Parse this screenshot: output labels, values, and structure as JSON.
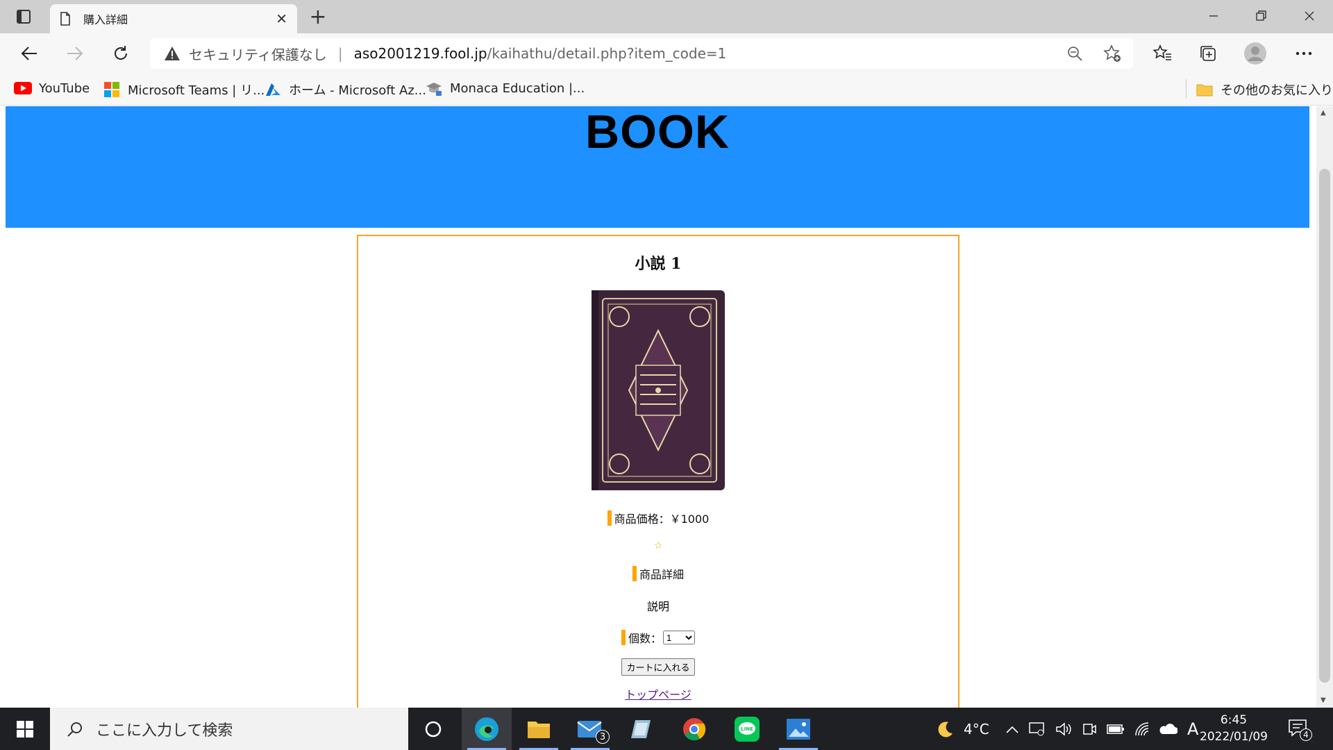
{
  "browser": {
    "tab_title": "購入詳細",
    "security_label": "セキュリティ保護なし",
    "url_host": "aso2001219.fool.jp",
    "url_path": "/kaihathu/detail.php?item_code=1"
  },
  "bookmarks": [
    {
      "label": "YouTube",
      "icon": "youtube-icon"
    },
    {
      "label": "Microsoft Teams | リ...",
      "icon": "microsoft-icon"
    },
    {
      "label": "ホーム - Microsoft Az...",
      "icon": "azure-icon"
    },
    {
      "label": "Monaca Education |...",
      "icon": "graduation-cap-icon"
    }
  ],
  "other_favorites": "その他のお気に入り",
  "page": {
    "site_title": "BOOK",
    "product_name": "小説 1",
    "price_label": "商品価格：￥1000",
    "rating_star": "☆",
    "detail_label": "商品詳細",
    "description": "説明",
    "quantity_label": "個数：",
    "quantity_value": "1",
    "add_to_cart": "カートに入れる",
    "top_page_link": "トップページ"
  },
  "taskbar": {
    "search_placeholder": "ここに入力して検索",
    "mail_badge": "3",
    "weather": "4°C",
    "ime": "A",
    "time": "6:45",
    "date": "2022/01/09",
    "notification_count": "4"
  },
  "colors": {
    "header_bg": "#1e90ff",
    "card_border": "#f5a623",
    "accent_bar": "#ffa500"
  }
}
